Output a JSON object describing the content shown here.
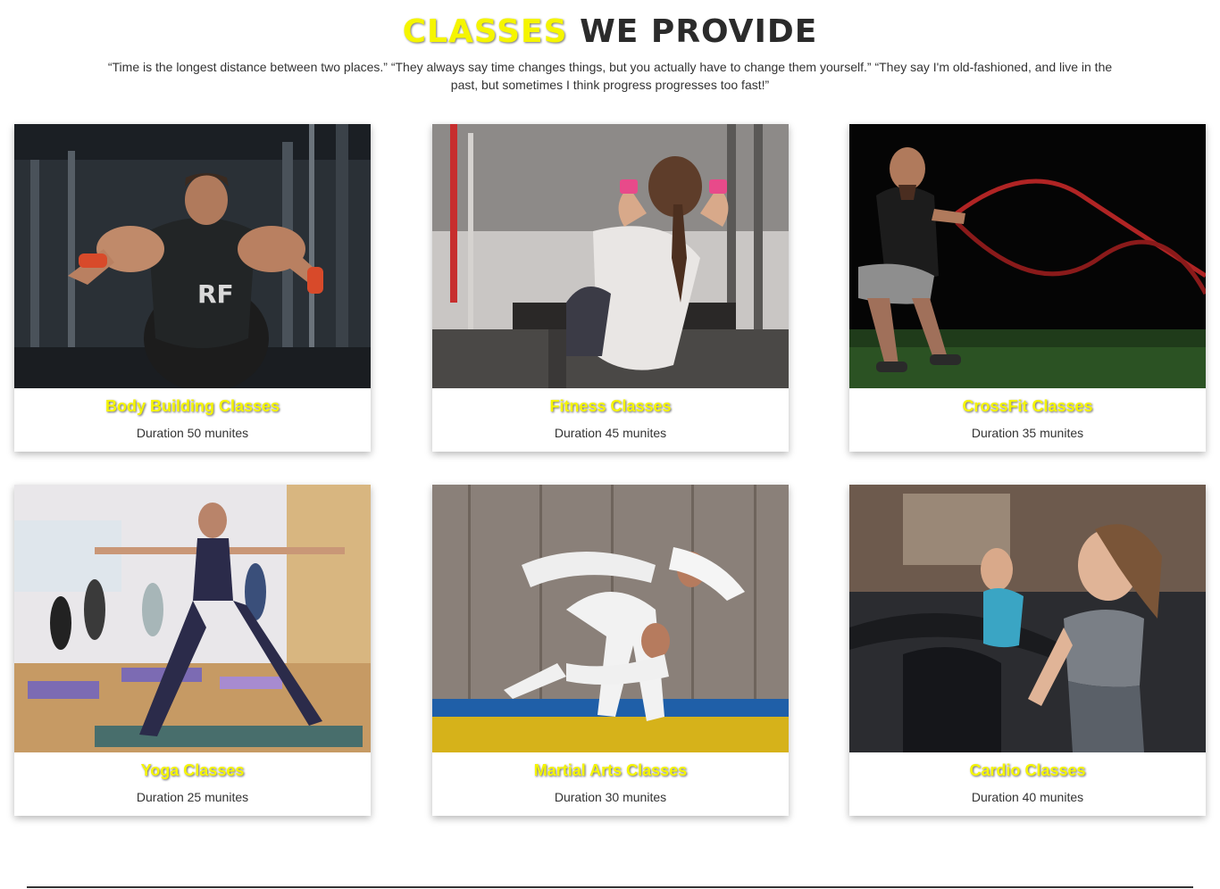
{
  "section": {
    "title_accent": "CLASSES",
    "title_rest": " WE PROVIDE",
    "quote": "“Time is the longest distance between two places.” “They always say time changes things, but you actually have to change them yourself.” “They say I'm old-fashioned, and live in the past, but sometimes I think progress progresses too fast!”"
  },
  "colors": {
    "accent": "#f5f500",
    "heading_dark": "#2b2b2b",
    "text": "#333333"
  },
  "classes": [
    {
      "name": "Body Building Classes",
      "duration": "Duration 50 munites",
      "photo": "bodybuilding-photo"
    },
    {
      "name": "Fitness Classes",
      "duration": "Duration 45 munites",
      "photo": "fitness-photo"
    },
    {
      "name": "CrossFit Classes",
      "duration": "Duration 35 munites",
      "photo": "crossfit-photo"
    },
    {
      "name": "Yoga Classes",
      "duration": "Duration 25 munites",
      "photo": "yoga-photo"
    },
    {
      "name": "Martial Arts Classes",
      "duration": "Duration 30 munites",
      "photo": "martial-arts-photo"
    },
    {
      "name": "Cardio Classes",
      "duration": "Duration 40 munites",
      "photo": "cardio-photo"
    }
  ]
}
